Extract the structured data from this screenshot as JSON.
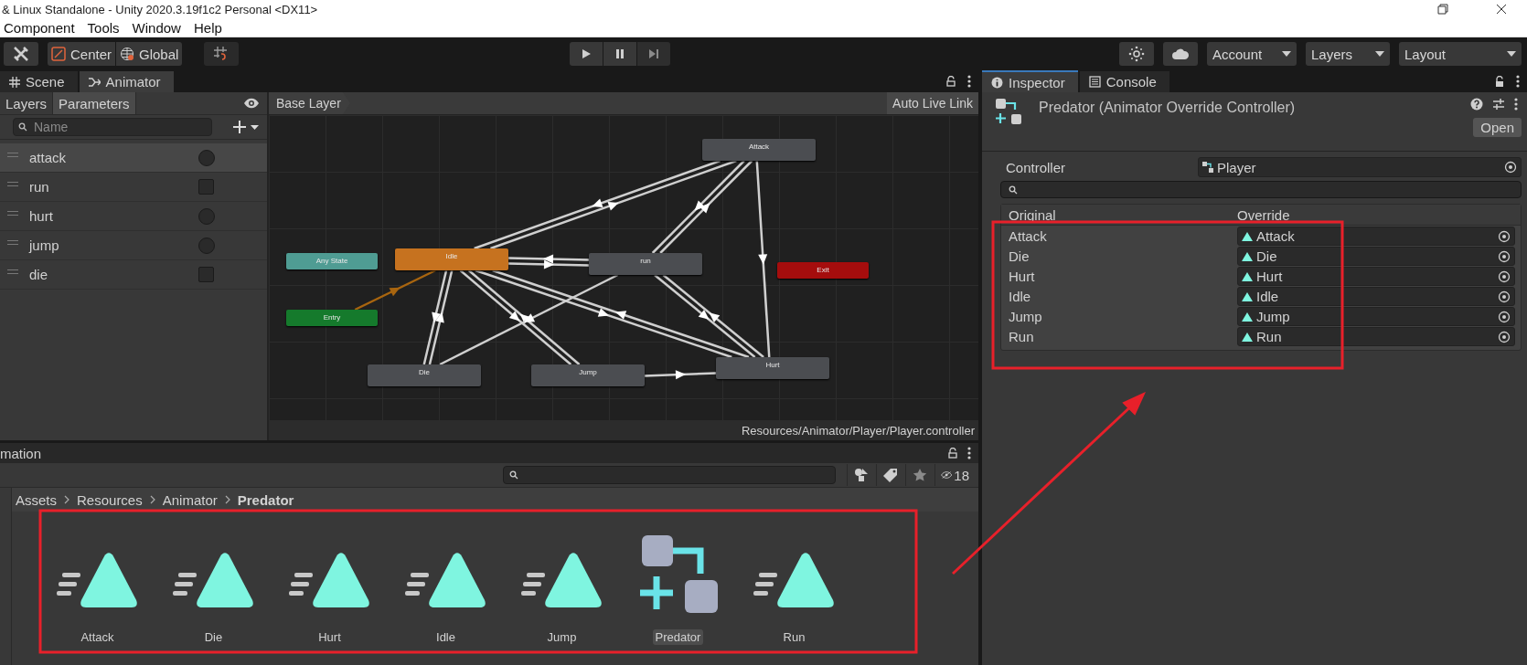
{
  "window": {
    "title": "& Linux Standalone - Unity 2020.3.19f1c2 Personal <DX11>"
  },
  "menu": [
    "Component",
    "Tools",
    "Window",
    "Help"
  ],
  "toolbar": {
    "pivot": "Center",
    "space": "Global",
    "dropdowns": [
      "Account",
      "Layers",
      "Layout"
    ]
  },
  "left_tabs": [
    {
      "label": "Scene",
      "selected": false
    },
    {
      "label": "Animator",
      "selected": true
    }
  ],
  "animator": {
    "sub_tabs": [
      {
        "label": "Layers",
        "selected": false
      },
      {
        "label": "Parameters",
        "selected": true
      }
    ],
    "search": {
      "placeholder": "Name"
    },
    "parameters": [
      {
        "name": "attack",
        "kind": "trigger",
        "checked": false,
        "selected": true
      },
      {
        "name": "run",
        "kind": "bool",
        "checked": false,
        "selected": false
      },
      {
        "name": "hurt",
        "kind": "trigger",
        "checked": false,
        "selected": false
      },
      {
        "name": "jump",
        "kind": "trigger",
        "checked": false,
        "selected": false
      },
      {
        "name": "die",
        "kind": "bool",
        "checked": false,
        "selected": false
      }
    ],
    "breadcrumb": "Base Layer",
    "live_link": "Auto Live Link",
    "nodes": [
      {
        "name": "Attack",
        "kind": "state"
      },
      {
        "name": "Any State",
        "kind": "any"
      },
      {
        "name": "Idle",
        "kind": "default"
      },
      {
        "name": "run",
        "kind": "state"
      },
      {
        "name": "Exit",
        "kind": "exit"
      },
      {
        "name": "Entry",
        "kind": "entry"
      },
      {
        "name": "Die",
        "kind": "state"
      },
      {
        "name": "Jump",
        "kind": "state"
      },
      {
        "name": "Hurt",
        "kind": "state"
      }
    ],
    "path": "Resources/Animator/Player/Player.controller"
  },
  "project": {
    "title": "mation",
    "hidden_count": "18",
    "breadcrumb": [
      {
        "label": "Assets",
        "current": false
      },
      {
        "label": "Resources",
        "current": false
      },
      {
        "label": "Animator",
        "current": false
      },
      {
        "label": "Predator",
        "current": true
      }
    ],
    "assets": [
      {
        "name": "Attack",
        "kind": "clip",
        "selected": false
      },
      {
        "name": "Die",
        "kind": "clip",
        "selected": false
      },
      {
        "name": "Hurt",
        "kind": "clip",
        "selected": false
      },
      {
        "name": "Idle",
        "kind": "clip",
        "selected": false
      },
      {
        "name": "Jump",
        "kind": "clip",
        "selected": false
      },
      {
        "name": "Predator",
        "kind": "override",
        "selected": true
      },
      {
        "name": "Run",
        "kind": "clip",
        "selected": false
      }
    ]
  },
  "inspector": {
    "tabs": [
      {
        "label": "Inspector",
        "selected": true
      },
      {
        "label": "Console",
        "selected": false
      }
    ],
    "title": "Predator (Animator Override Controller)",
    "open_button": "Open",
    "controller": {
      "label": "Controller",
      "value": "Player"
    },
    "columns": [
      "Original",
      "Override"
    ],
    "rows": [
      {
        "original": "Attack",
        "override": "Attack"
      },
      {
        "original": "Die",
        "override": "Die"
      },
      {
        "original": "Hurt",
        "override": "Hurt"
      },
      {
        "original": "Idle",
        "override": "Idle"
      },
      {
        "original": "Jump",
        "override": "Jump"
      },
      {
        "original": "Run",
        "override": "Run"
      }
    ]
  },
  "annotations": {
    "override_box": true,
    "assets_box": true,
    "arrow": true
  }
}
